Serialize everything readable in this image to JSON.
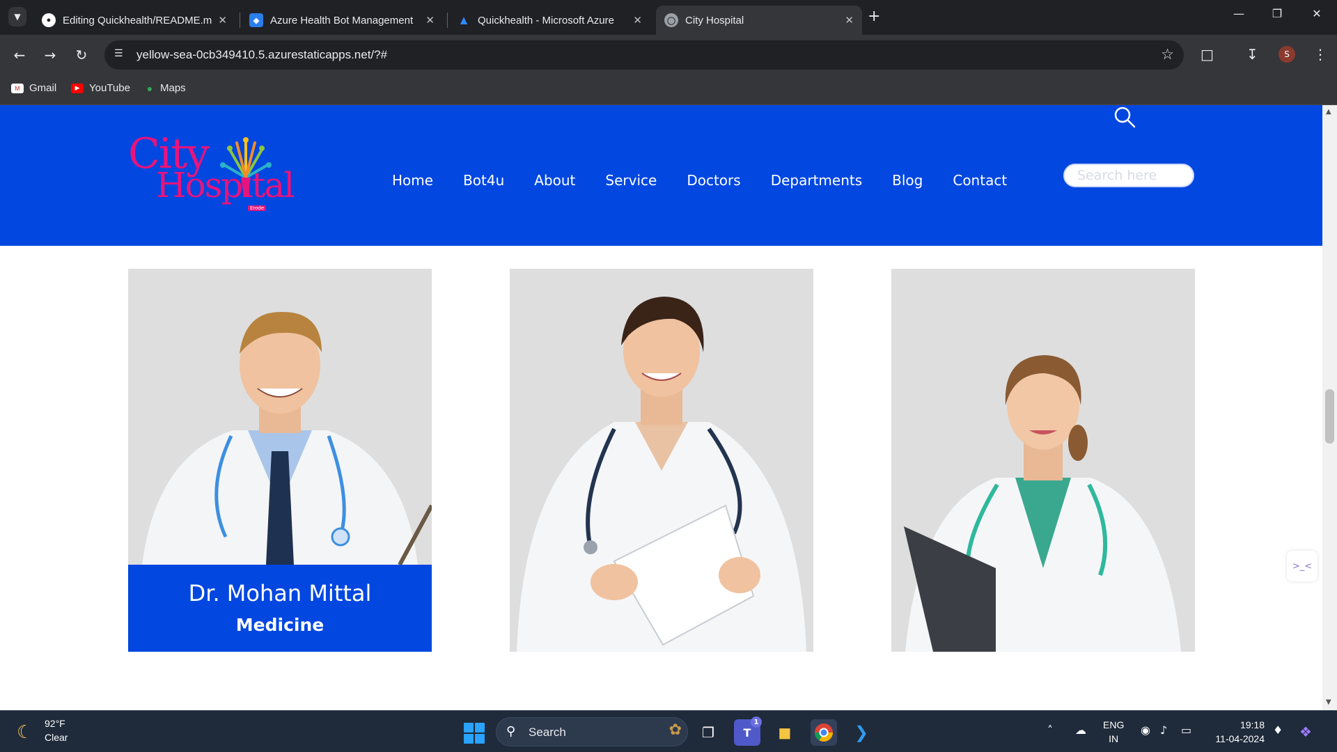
{
  "browser": {
    "tabs": [
      {
        "title": "Editing Quickhealth/README.m",
        "icon": "github-icon",
        "active": false
      },
      {
        "title": "Azure Health Bot Management",
        "icon": "health-bot-icon",
        "active": false
      },
      {
        "title": "Quickhealth - Microsoft Azure",
        "icon": "azure-icon",
        "active": false
      },
      {
        "title": "City Hospital",
        "icon": "globe-icon",
        "active": true
      }
    ],
    "url": "yellow-sea-0cb349410.5.azurestaticapps.net/?#",
    "profile_initial": "S",
    "bookmarks": [
      {
        "label": "Gmail",
        "icon": "gmail-icon"
      },
      {
        "label": "YouTube",
        "icon": "youtube-icon"
      },
      {
        "label": "Maps",
        "icon": "maps-icon"
      }
    ]
  },
  "site": {
    "logo": {
      "line1": "City",
      "line2": "Hospital",
      "tag": "Erode"
    },
    "nav": [
      "Home",
      "Bot4u",
      "About",
      "Service",
      "Doctors",
      "Departments",
      "Blog",
      "Contact"
    ],
    "search_placeholder": "Search here",
    "doctors": [
      {
        "name": "Dr. Mohan Mittal",
        "department": "Medicine"
      },
      {
        "name": "",
        "department": ""
      },
      {
        "name": "",
        "department": ""
      }
    ]
  },
  "taskbar": {
    "weather": {
      "temp": "92°F",
      "condition": "Clear"
    },
    "search_label": "Search",
    "teams_badge": "1",
    "language": {
      "line1": "ENG",
      "line2": "IN"
    },
    "time": "19:18",
    "date": "11-04-2024"
  },
  "colors": {
    "brand_blue": "#0147e0",
    "logo_pink": "#e8147d",
    "chrome_dark": "#202124",
    "taskbar": "#1f2a3a"
  }
}
